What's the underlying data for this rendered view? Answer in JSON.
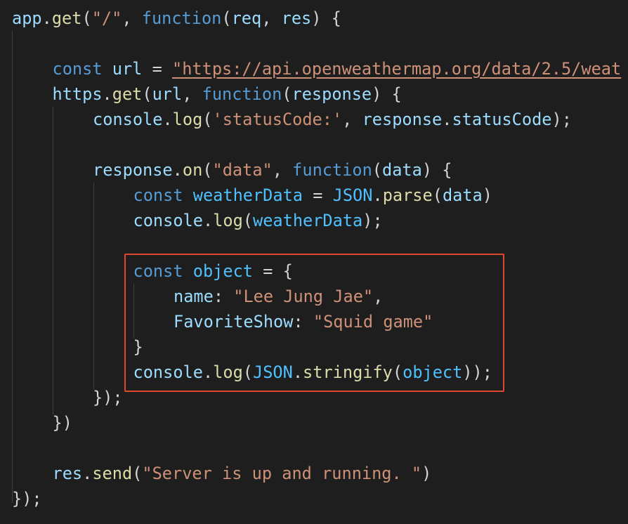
{
  "colors": {
    "background": "#1e1e1e",
    "default": "#d4d4d4",
    "variable": "#9cdcfe",
    "constant": "#4fc1ff",
    "function": "#dcdcaa",
    "keyword": "#569cd6",
    "string": "#ce9178",
    "highlight_border": "#e0482f"
  },
  "code_lines": [
    {
      "indent": 0,
      "tokens": [
        {
          "t": "app",
          "c": "variable"
        },
        {
          "t": ".",
          "c": "default"
        },
        {
          "t": "get",
          "c": "function"
        },
        {
          "t": "(",
          "c": "default"
        },
        {
          "t": "\"/\"",
          "c": "string"
        },
        {
          "t": ", ",
          "c": "default"
        },
        {
          "t": "function",
          "c": "keyword"
        },
        {
          "t": "(",
          "c": "default"
        },
        {
          "t": "req",
          "c": "variable"
        },
        {
          "t": ", ",
          "c": "default"
        },
        {
          "t": "res",
          "c": "variable"
        },
        {
          "t": ") {",
          "c": "default"
        }
      ]
    },
    {
      "indent": 0,
      "tokens": []
    },
    {
      "indent": 1,
      "tokens": [
        {
          "t": "const",
          "c": "keyword"
        },
        {
          "t": " ",
          "c": "default"
        },
        {
          "t": "url",
          "c": "variable"
        },
        {
          "t": " = ",
          "c": "default"
        },
        {
          "t": "\"https://api.openweathermap.org/data/2.5/weat",
          "c": "string",
          "u": true
        }
      ]
    },
    {
      "indent": 1,
      "tokens": [
        {
          "t": "https",
          "c": "variable"
        },
        {
          "t": ".",
          "c": "default"
        },
        {
          "t": "get",
          "c": "function"
        },
        {
          "t": "(",
          "c": "default"
        },
        {
          "t": "url",
          "c": "variable"
        },
        {
          "t": ", ",
          "c": "default"
        },
        {
          "t": "function",
          "c": "keyword"
        },
        {
          "t": "(",
          "c": "default"
        },
        {
          "t": "response",
          "c": "variable"
        },
        {
          "t": ") {",
          "c": "default"
        }
      ]
    },
    {
      "indent": 2,
      "tokens": [
        {
          "t": "console",
          "c": "variable"
        },
        {
          "t": ".",
          "c": "default"
        },
        {
          "t": "log",
          "c": "function"
        },
        {
          "t": "(",
          "c": "default"
        },
        {
          "t": "'statusCode:'",
          "c": "string"
        },
        {
          "t": ", ",
          "c": "default"
        },
        {
          "t": "response",
          "c": "variable"
        },
        {
          "t": ".",
          "c": "default"
        },
        {
          "t": "statusCode",
          "c": "variable"
        },
        {
          "t": ");",
          "c": "default"
        }
      ]
    },
    {
      "indent": 0,
      "tokens": []
    },
    {
      "indent": 2,
      "tokens": [
        {
          "t": "response",
          "c": "variable"
        },
        {
          "t": ".",
          "c": "default"
        },
        {
          "t": "on",
          "c": "function"
        },
        {
          "t": "(",
          "c": "default"
        },
        {
          "t": "\"data\"",
          "c": "string"
        },
        {
          "t": ", ",
          "c": "default"
        },
        {
          "t": "function",
          "c": "keyword"
        },
        {
          "t": "(",
          "c": "default"
        },
        {
          "t": "data",
          "c": "variable"
        },
        {
          "t": ") {",
          "c": "default"
        }
      ]
    },
    {
      "indent": 3,
      "tokens": [
        {
          "t": "const",
          "c": "keyword"
        },
        {
          "t": " ",
          "c": "default"
        },
        {
          "t": "weatherData",
          "c": "constant"
        },
        {
          "t": " = ",
          "c": "default"
        },
        {
          "t": "JSON",
          "c": "constant"
        },
        {
          "t": ".",
          "c": "default"
        },
        {
          "t": "parse",
          "c": "function"
        },
        {
          "t": "(",
          "c": "default"
        },
        {
          "t": "data",
          "c": "variable"
        },
        {
          "t": ")",
          "c": "default"
        }
      ]
    },
    {
      "indent": 3,
      "tokens": [
        {
          "t": "console",
          "c": "variable"
        },
        {
          "t": ".",
          "c": "default"
        },
        {
          "t": "log",
          "c": "function"
        },
        {
          "t": "(",
          "c": "default"
        },
        {
          "t": "weatherData",
          "c": "constant"
        },
        {
          "t": ");",
          "c": "default"
        }
      ]
    },
    {
      "indent": 0,
      "tokens": []
    },
    {
      "indent": 3,
      "tokens": [
        {
          "t": "const",
          "c": "keyword"
        },
        {
          "t": " ",
          "c": "default"
        },
        {
          "t": "object",
          "c": "constant"
        },
        {
          "t": " = {",
          "c": "default"
        }
      ]
    },
    {
      "indent": 4,
      "tokens": [
        {
          "t": "name",
          "c": "variable"
        },
        {
          "t": ": ",
          "c": "default"
        },
        {
          "t": "\"Lee Jung Jae\"",
          "c": "string"
        },
        {
          "t": ",",
          "c": "default"
        }
      ]
    },
    {
      "indent": 4,
      "tokens": [
        {
          "t": "FavoriteShow",
          "c": "variable"
        },
        {
          "t": ": ",
          "c": "default"
        },
        {
          "t": "\"Squid game\"",
          "c": "string"
        }
      ]
    },
    {
      "indent": 3,
      "tokens": [
        {
          "t": "}",
          "c": "default"
        }
      ]
    },
    {
      "indent": 3,
      "tokens": [
        {
          "t": "console",
          "c": "variable"
        },
        {
          "t": ".",
          "c": "default"
        },
        {
          "t": "log",
          "c": "function"
        },
        {
          "t": "(",
          "c": "default"
        },
        {
          "t": "JSON",
          "c": "constant"
        },
        {
          "t": ".",
          "c": "default"
        },
        {
          "t": "stringify",
          "c": "function"
        },
        {
          "t": "(",
          "c": "default"
        },
        {
          "t": "object",
          "c": "constant"
        },
        {
          "t": "));",
          "c": "default"
        }
      ]
    },
    {
      "indent": 2,
      "tokens": [
        {
          "t": "});",
          "c": "default"
        }
      ]
    },
    {
      "indent": 1,
      "tokens": [
        {
          "t": "})",
          "c": "default"
        }
      ]
    },
    {
      "indent": 0,
      "tokens": []
    },
    {
      "indent": 1,
      "tokens": [
        {
          "t": "res",
          "c": "variable"
        },
        {
          "t": ".",
          "c": "default"
        },
        {
          "t": "send",
          "c": "function"
        },
        {
          "t": "(",
          "c": "default"
        },
        {
          "t": "\"Server is up and running. \"",
          "c": "string"
        },
        {
          "t": ")",
          "c": "default"
        }
      ]
    },
    {
      "indent": 0,
      "tokens": [
        {
          "t": "});",
          "c": "default"
        }
      ]
    }
  ]
}
